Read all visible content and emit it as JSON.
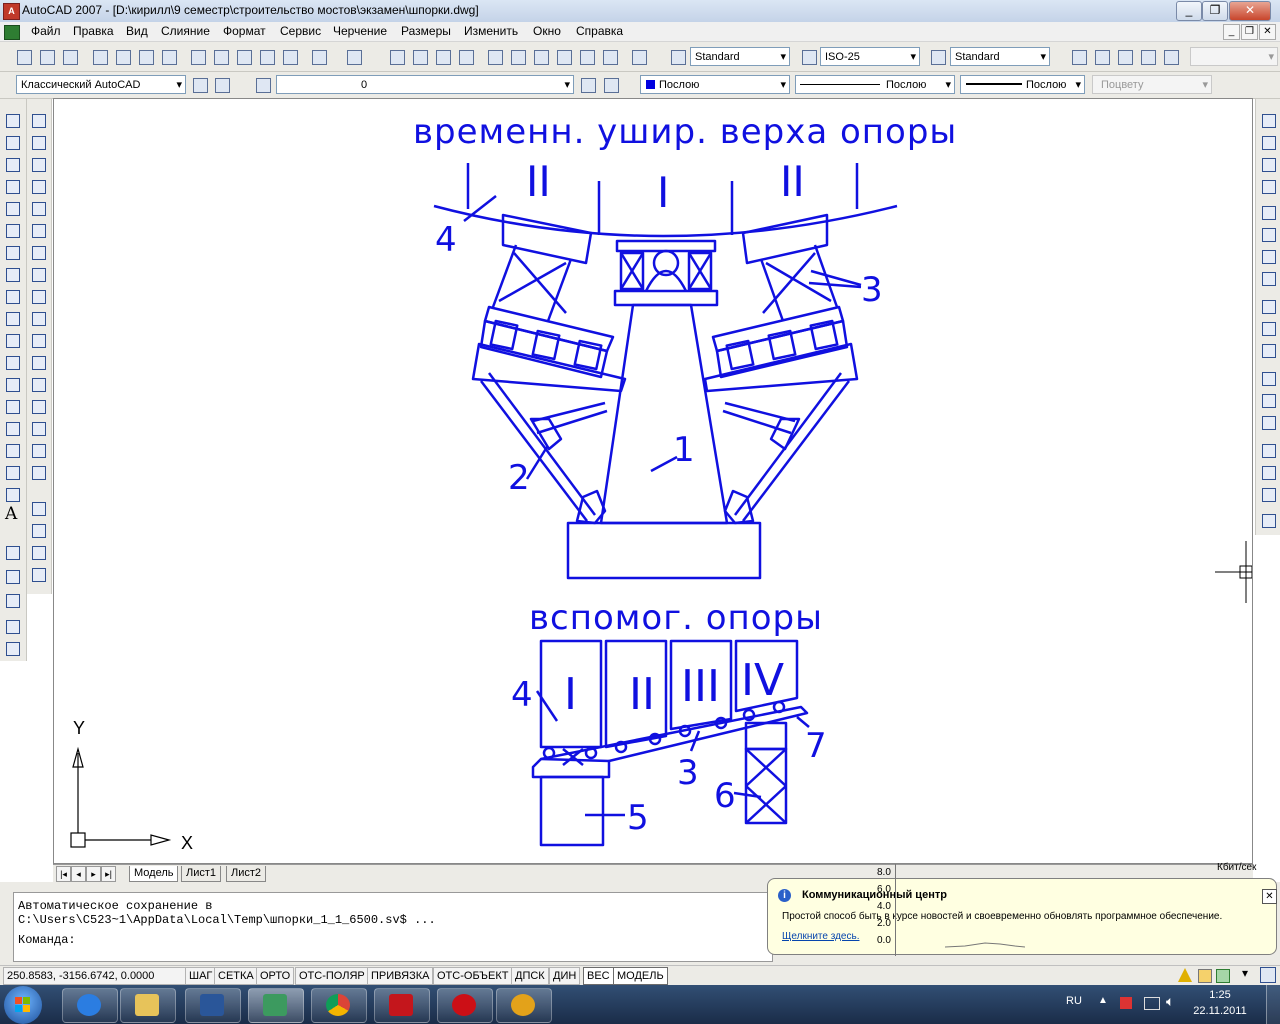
{
  "window": {
    "title": "AutoCAD 2007 - [D:\\кирилл\\9 семестр\\строительство мостов\\экзамен\\шпорки.dwg]",
    "app_icon": "acad-icon"
  },
  "menu": [
    "Файл",
    "Правка",
    "Вид",
    "Слияние",
    "Формат",
    "Сервис",
    "Черчение",
    "Размеры",
    "Изменить",
    "Окно",
    "Справка"
  ],
  "styles": {
    "text_style": "Standard",
    "dim_style": "ISO-25",
    "table_style": "Standard"
  },
  "properties": {
    "workspace": "Классический AutoCAD",
    "layer": "0",
    "color": "Послою",
    "linetype": "Послою",
    "lineweight": "Послою",
    "plotstyle": "Поцвету"
  },
  "drawing": {
    "color": "#1010e0",
    "label_top": "временн. ушир. верха опоры",
    "label_bottom": "вспомог. опоры",
    "roman": [
      "II",
      "I",
      "II"
    ],
    "callouts": [
      "4",
      "3",
      "2",
      "1"
    ],
    "bottom_panels": [
      "I",
      "II",
      "III",
      "IV"
    ],
    "bottom_callouts": [
      "4",
      "3",
      "5",
      "6",
      "7"
    ],
    "ucs_y": "Y",
    "ucs_x": "X"
  },
  "tabs": {
    "model": "Модель",
    "sheet1": "Лист1",
    "sheet2": "Лист2"
  },
  "command": {
    "line1": "Автоматическое сохранение в",
    "line2": "C:\\Users\\C523~1\\AppData\\Local\\Temp\\шпорки_1_1_6500.sv$ ...",
    "prompt": "Команда:"
  },
  "status": {
    "coords": "250.8583, -3156.6742, 0.0000",
    "buttons": [
      "ШАГ",
      "СЕТКА",
      "ОРТО",
      "ОТС-ПОЛЯР",
      "ПРИВЯЗКА",
      "ОТС-ОБЪЕКТ",
      "ДПСК",
      "ДИН",
      "ВЕС",
      "МОДЕЛЬ"
    ]
  },
  "balloon": {
    "title": "Коммуникационный центр",
    "text": "Простой способ быть в курсе новостей и своевременно обновлять программное обеспечение.",
    "link": "Щелкните здесь."
  },
  "netgraph": {
    "unit": "Кбит/сек",
    "ticks": [
      "8.0",
      "6.0",
      "4.0",
      "2.0",
      "0.0"
    ]
  },
  "tray": {
    "lang": "RU",
    "time": "1:25",
    "date": "22.11.2011"
  }
}
